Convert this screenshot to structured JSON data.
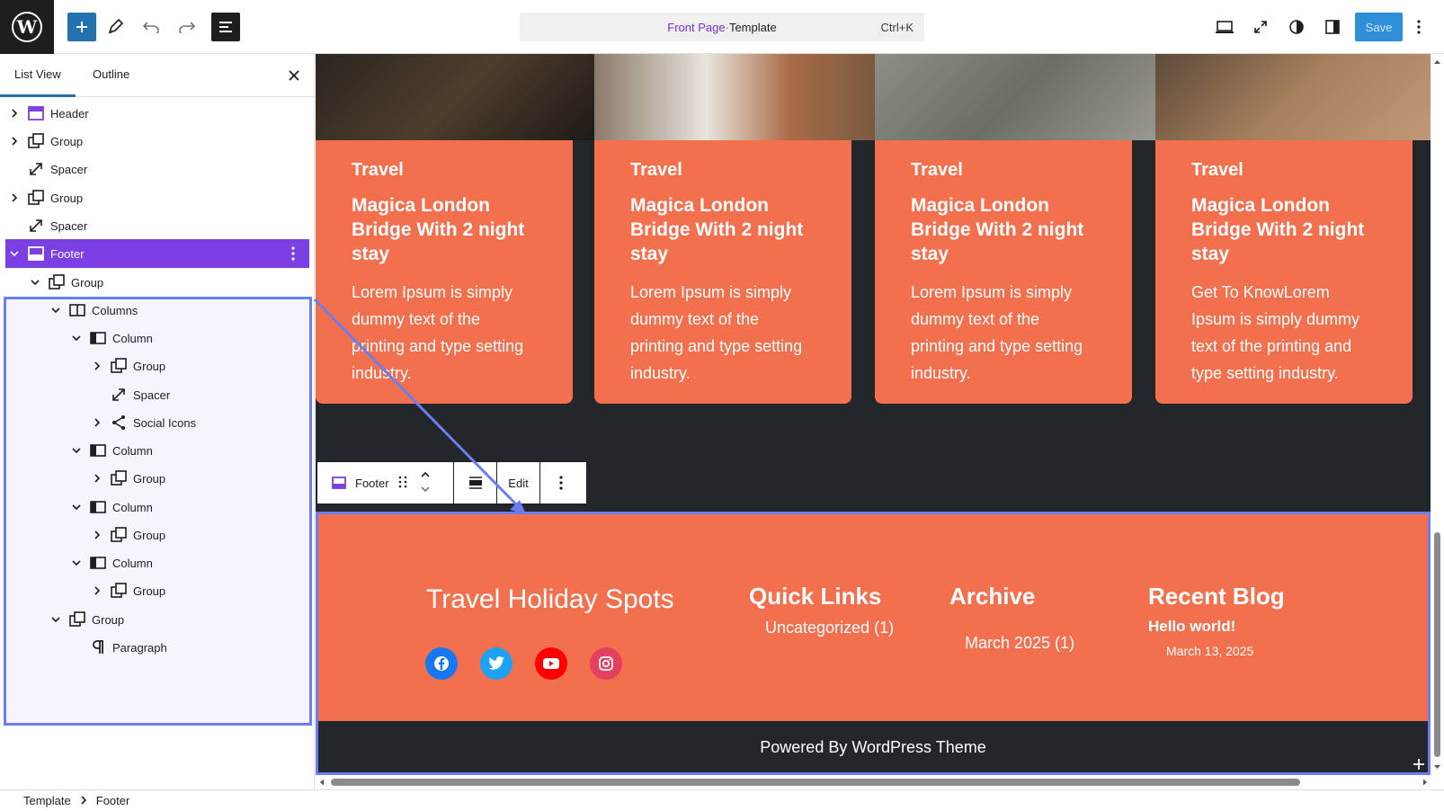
{
  "topbar": {
    "command_bar": {
      "title": "Front Page",
      "separator": " · ",
      "type": "Template",
      "shortcut": "Ctrl+K"
    },
    "save_label": "Save"
  },
  "sidebar": {
    "tabs": [
      "List View",
      "Outline"
    ],
    "items": [
      {
        "label": "Header",
        "icon": "header-icon",
        "depth": 0,
        "chev": "right"
      },
      {
        "label": "Group",
        "icon": "group-icon",
        "depth": 0,
        "chev": "right"
      },
      {
        "label": "Spacer",
        "icon": "spacer-icon",
        "depth": 0,
        "chev": ""
      },
      {
        "label": "Group",
        "icon": "group-icon",
        "depth": 0,
        "chev": "right"
      },
      {
        "label": "Spacer",
        "icon": "spacer-icon",
        "depth": 0,
        "chev": ""
      },
      {
        "label": "Footer",
        "icon": "footer-icon",
        "depth": 0,
        "chev": "down"
      },
      {
        "label": "Group",
        "icon": "group-icon",
        "depth": 1,
        "chev": "down"
      },
      {
        "label": "Columns",
        "icon": "columns-icon",
        "depth": 2,
        "chev": "down"
      },
      {
        "label": "Column",
        "icon": "column-icon",
        "depth": 3,
        "chev": "down"
      },
      {
        "label": "Group",
        "icon": "group-icon",
        "depth": 4,
        "chev": "right"
      },
      {
        "label": "Spacer",
        "icon": "spacer-icon",
        "depth": 4,
        "chev": ""
      },
      {
        "label": "Social Icons",
        "icon": "share-icon",
        "depth": 4,
        "chev": "right"
      },
      {
        "label": "Column",
        "icon": "column-icon",
        "depth": 3,
        "chev": "down"
      },
      {
        "label": "Group",
        "icon": "group-icon",
        "depth": 4,
        "chev": "right"
      },
      {
        "label": "Column",
        "icon": "column-icon",
        "depth": 3,
        "chev": "down"
      },
      {
        "label": "Group",
        "icon": "group-icon",
        "depth": 4,
        "chev": "right"
      },
      {
        "label": "Column",
        "icon": "column-icon",
        "depth": 3,
        "chev": "down"
      },
      {
        "label": "Group",
        "icon": "group-icon",
        "depth": 4,
        "chev": "right"
      },
      {
        "label": "Group",
        "icon": "group-icon",
        "depth": 2,
        "chev": "down"
      },
      {
        "label": "Paragraph",
        "icon": "paragraph-icon",
        "depth": 3,
        "chev": ""
      }
    ]
  },
  "cards": [
    {
      "category": "Travel",
      "title": "Magica London Bridge With 2 night stay",
      "text": "Lorem Ipsum is simply dummy text of the printing and type setting industry."
    },
    {
      "category": "Travel",
      "title": "Magica London Bridge With 2 night stay",
      "text": "Lorem Ipsum is simply dummy text of the printing and type setting industry."
    },
    {
      "category": "Travel",
      "title": "Magica London Bridge With 2 night stay",
      "text": "Lorem Ipsum is simply dummy text of the printing and type setting industry."
    },
    {
      "category": "Travel",
      "title": "Magica London Bridge With 2 night stay",
      "text": "Get To KnowLorem Ipsum is simply dummy text of the printing and type setting industry."
    }
  ],
  "block_toolbar": {
    "block_name": "Footer",
    "edit_label": "Edit"
  },
  "footer": {
    "site_title": "Travel Holiday Spots",
    "quick_links": {
      "heading": "Quick Links",
      "link": "Uncategorized (1)"
    },
    "archive": {
      "heading": "Archive",
      "link": "March 2025 (1)"
    },
    "recent_blog": {
      "heading": "Recent Blog",
      "post": "Hello world!",
      "date": "March 13, 2025"
    },
    "powered_by": "Powered By WordPress Theme"
  },
  "breadcrumb": [
    "Template",
    "Footer"
  ],
  "colors": {
    "accent": "#2271b1",
    "selection": "#7b3fe4",
    "card": "#f2704e",
    "dark": "#23262b",
    "outline": "#6b7ef0"
  }
}
